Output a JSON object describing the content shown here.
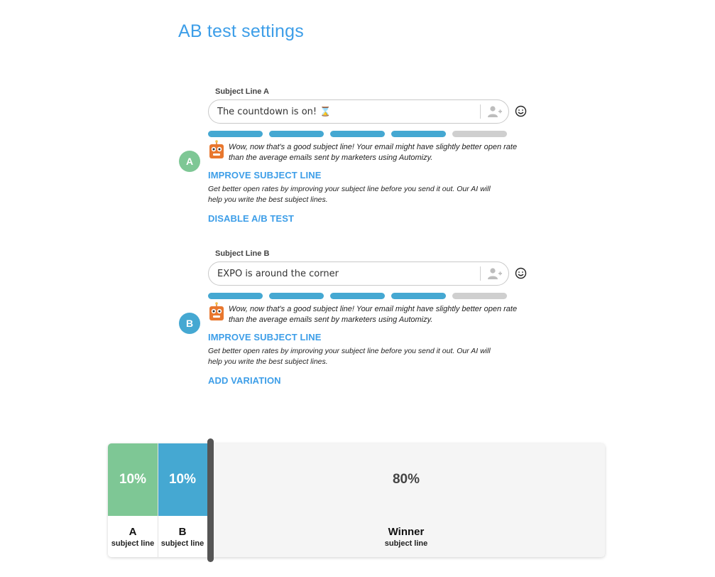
{
  "page": {
    "title": "AB test settings"
  },
  "variants": [
    {
      "badge": "A",
      "badge_color": "#7ec795",
      "label": "Subject Line A",
      "value": "The countdown is on! ⌛",
      "strength_filled": 4,
      "strength_total": 5,
      "feedback": "Wow, now that's a good subject line! Your email might have slightly better open rate than the average emails sent by marketers using Automizy.",
      "improve_label": "IMPROVE SUBJECT LINE",
      "improve_desc": "Get better open rates by improving your subject line before you send it out. Our AI will help you write the best subject lines.",
      "action_label": "DISABLE A/B TEST"
    },
    {
      "badge": "B",
      "badge_color": "#45a8d2",
      "label": "Subject Line B",
      "value": "EXPO is around the corner",
      "strength_filled": 4,
      "strength_total": 5,
      "feedback": "Wow, now that's a good subject line! Your email might have slightly better open rate than the average emails sent by marketers using Automizy.",
      "improve_label": "IMPROVE SUBJECT LINE",
      "improve_desc": "Get better open rates by improving your subject line before you send it out. Our AI will help you write the best subject lines.",
      "action_label": "ADD VARIATION"
    }
  ],
  "split": [
    {
      "percent": 10,
      "percent_label": "10%",
      "name": "A",
      "sub": "subject line",
      "color": "#7ec795"
    },
    {
      "percent": 10,
      "percent_label": "10%",
      "name": "B",
      "sub": "subject line",
      "color": "#45a8d2"
    },
    {
      "percent": 80,
      "percent_label": "80%",
      "name": "Winner",
      "sub": "subject line",
      "color": "#f5f5f5"
    }
  ],
  "colors": {
    "accent": "#3d9ee8",
    "strength_filled": "#45a8d2",
    "strength_empty": "#cfcfcf",
    "robot": "#e8772e"
  }
}
